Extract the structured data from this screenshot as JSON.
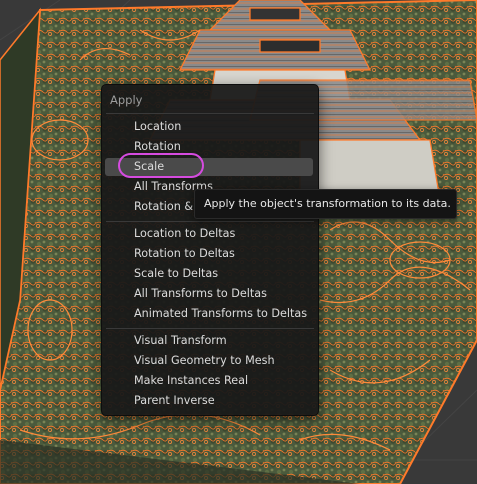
{
  "menu": {
    "title": "Apply",
    "groups": [
      [
        {
          "label": "Location",
          "u": "L",
          "rest": "ocation"
        },
        {
          "label": "Rotation",
          "u": "R",
          "rest": "otation"
        },
        {
          "label": "Scale",
          "u": "S",
          "rest": "cale"
        },
        {
          "label": "All Transforms",
          "u": "A",
          "rest": "ll Transforms"
        },
        {
          "label": "Rotation & Scale",
          "u": "R",
          "rest": "otation & "
        }
      ],
      [
        {
          "label": "Location to Deltas"
        },
        {
          "label": "Rotation to Deltas"
        },
        {
          "label": "Scale to Deltas"
        },
        {
          "label": "All Transforms to Deltas"
        },
        {
          "label": "Animated Transforms to Deltas"
        }
      ],
      [
        {
          "label": "Visual Transform"
        },
        {
          "label": "Visual Geometry to Mesh"
        },
        {
          "label": "Make Instances Real"
        },
        {
          "label": "Parent Inverse"
        }
      ]
    ]
  },
  "items": {
    "location": "Location",
    "rotation": "Rotation",
    "scale": "Scale",
    "all_transforms": "All Transforms",
    "rotation_scale": "Rotation &",
    "location_deltas": "Location to Deltas",
    "rotation_deltas": "Rotation to Deltas",
    "scale_deltas": "Scale to Deltas",
    "all_transforms_deltas": "All Transforms to Deltas",
    "animated_deltas": "Animated Transforms to Deltas",
    "visual_transform": "Visual Transform",
    "visual_geometry": "Visual Geometry to Mesh",
    "make_instances_real": "Make Instances Real",
    "parent_inverse": "Parent Inverse"
  },
  "tooltip": {
    "text": "Apply the object's transformation to its data."
  },
  "colors": {
    "highlight_ring": "#d64be0",
    "wireframe_outline": "#ff7a2a",
    "menu_bg": "#181818"
  },
  "icons": {
    "viewport": "3d-viewport-wireframe"
  }
}
